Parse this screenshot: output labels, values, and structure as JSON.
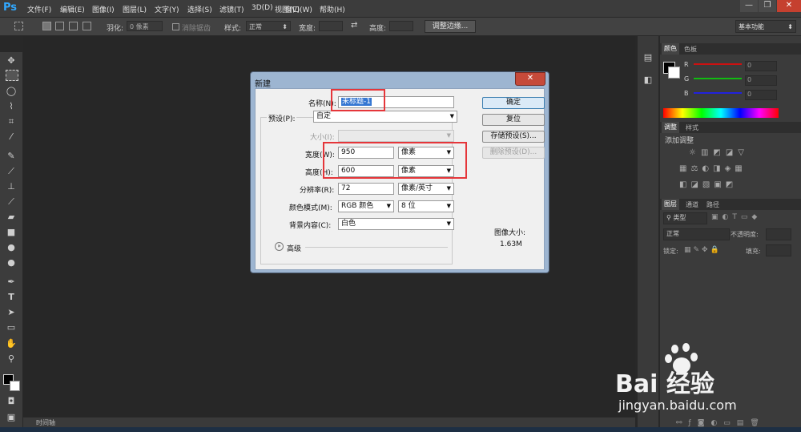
{
  "app": {
    "logo": "Ps"
  },
  "menu": [
    "文件(F)",
    "编辑(E)",
    "图像(I)",
    "图层(L)",
    "文字(Y)",
    "选择(S)",
    "滤镜(T)",
    "3D(D)",
    "视图(V)",
    "窗口(W)",
    "帮助(H)"
  ],
  "window_controls": {
    "minimize": "—",
    "restore": "❐",
    "close": "✕"
  },
  "options": {
    "feather_label": "羽化:",
    "feather_value": "0 像素",
    "antialias_label": "消除锯齿",
    "style_label": "样式:",
    "style_value": "正常",
    "width_label": "宽度:",
    "height_label": "高度:",
    "refine_edge": "调整边缘...",
    "workspace": "基本功能"
  },
  "panels": {
    "color_tabs": [
      "颜色",
      "色板"
    ],
    "channels": [
      "R",
      "G",
      "B"
    ],
    "channel_values": [
      "0",
      "0",
      "0"
    ],
    "adjust_tabs": [
      "调整",
      "样式"
    ],
    "adjust_title": "添加调整",
    "layers_tabs": [
      "图层",
      "通道",
      "路径"
    ],
    "layers_filter": "类型",
    "blend_mode": "正常",
    "opacity_label": "不透明度:",
    "lock_label": "锁定:",
    "fill_label": "填充:"
  },
  "timeline": {
    "label": "时间轴"
  },
  "dialog": {
    "title": "新建",
    "close_glyph": "✕",
    "name_label": "名称(N):",
    "name_value": "未标题-1",
    "preset_label": "预设(P):",
    "preset_value": "自定",
    "size_label": "大小(I):",
    "width_label": "宽度(W):",
    "width_value": "950",
    "width_unit": "像素",
    "height_label": "高度(H):",
    "height_value": "600",
    "height_unit": "像素",
    "resolution_label": "分辨率(R):",
    "resolution_value": "72",
    "resolution_unit": "像素/英寸",
    "color_mode_label": "颜色模式(M):",
    "color_mode_value": "RGB 颜色",
    "bit_depth_value": "8 位",
    "background_label": "背景内容(C):",
    "background_value": "白色",
    "advanced_label": "高级",
    "ok_button": "确定",
    "reset_button": "复位",
    "save_preset_button": "存储预设(S)...",
    "delete_preset_button": "删除预设(D)...",
    "image_size_label": "图像大小:",
    "image_size_value": "1.63M"
  },
  "watermark": {
    "brand": "Bai 经验",
    "url": "jingyan.baidu.com"
  },
  "colors": {
    "accent_red": "#e5363a",
    "dialog_frame": "#9db5d1",
    "ps_blue": "#31a8ff"
  }
}
